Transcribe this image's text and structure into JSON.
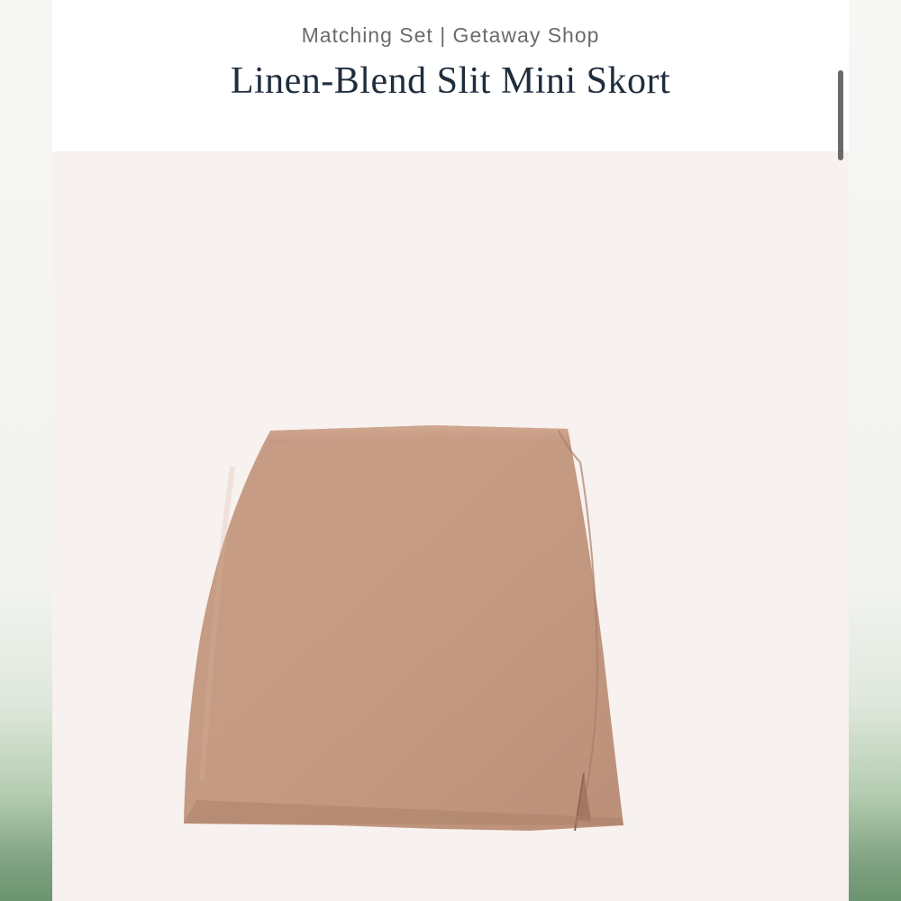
{
  "header": {
    "breadcrumb": "Matching Set | Getaway Shop",
    "title": "Linen-Blend Slit Mini Skort"
  },
  "product_image": {
    "description_icon": "skort-product-image",
    "fabric_color": "#c99e86"
  },
  "colors": {
    "page_background": "#ffffff",
    "image_background": "#f7f1ef",
    "title_color": "#1f2d3d",
    "breadcrumb_color": "#6b6b6b"
  }
}
